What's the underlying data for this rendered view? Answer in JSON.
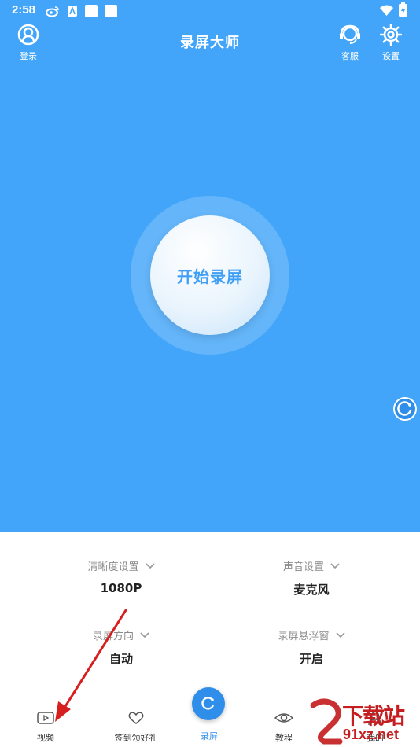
{
  "status_bar": {
    "time": "2:58"
  },
  "header": {
    "title": "录屏大师",
    "login_label": "登录",
    "service_label": "客服",
    "settings_label": "设置"
  },
  "record": {
    "label": "开始录屏"
  },
  "settings": [
    {
      "label": "清晰度设置",
      "value": "1080P"
    },
    {
      "label": "声音设置",
      "value": "麦克风"
    },
    {
      "label": "录屏方向",
      "value": "自动"
    },
    {
      "label": "录屏悬浮窗",
      "value": "开启"
    }
  ],
  "tabs": [
    {
      "label": "视频"
    },
    {
      "label": "签到领好礼"
    },
    {
      "label": "录屏"
    },
    {
      "label": "教程"
    },
    {
      "label": "我的"
    }
  ],
  "watermark": {
    "line1": "下载站",
    "line2": "91xz.net"
  },
  "colors": {
    "primary": "#42a5f9",
    "accent": "#2f8ee9",
    "annotation": "#d71f1f"
  }
}
